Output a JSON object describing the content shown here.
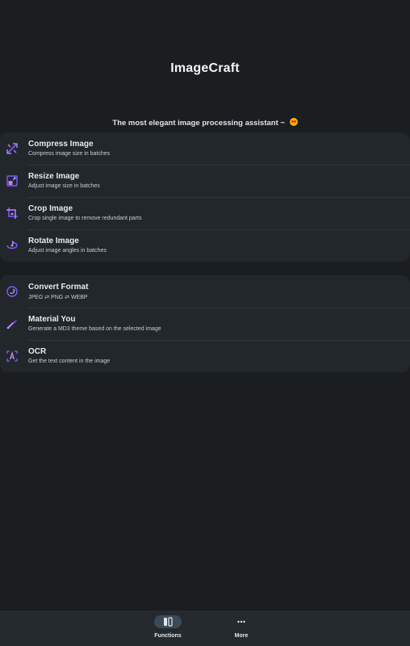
{
  "app": {
    "title": "ImageCraft",
    "tagline": "The most elegant image processing assistant ~"
  },
  "colors": {
    "background": "#1b1e21",
    "card": "#22272b",
    "icon_accent": "#7c5cff",
    "nav_bar": "#252a2f",
    "nav_active": "#3a4a58"
  },
  "group1": [
    {
      "title": "Compress Image",
      "subtitle": "Compress image size in batches",
      "icon": "compress-icon"
    },
    {
      "title": "Resize Image",
      "subtitle": "Adjust image size in batches",
      "icon": "resize-icon"
    },
    {
      "title": "Crop Image",
      "subtitle": "Crop single image to remove redundant parts",
      "icon": "crop-icon"
    },
    {
      "title": "Rotate Image",
      "subtitle": "Adjust image angles in batches",
      "icon": "rotate-icon"
    }
  ],
  "group2": [
    {
      "title": "Convert Format",
      "subtitle": "JPEG ⇄ PNG ⇄ WEBP",
      "icon": "convert-icon"
    },
    {
      "title": "Material You",
      "subtitle": "Generate a MD3 theme based on the selected image",
      "icon": "palette-icon"
    },
    {
      "title": "OCR",
      "subtitle": "Get the text content in the image",
      "icon": "ocr-icon"
    }
  ],
  "nav": {
    "items": [
      {
        "label": "Functions",
        "icon": "functions-icon",
        "active": true
      },
      {
        "label": "More",
        "icon": "more-icon",
        "active": false
      }
    ]
  }
}
